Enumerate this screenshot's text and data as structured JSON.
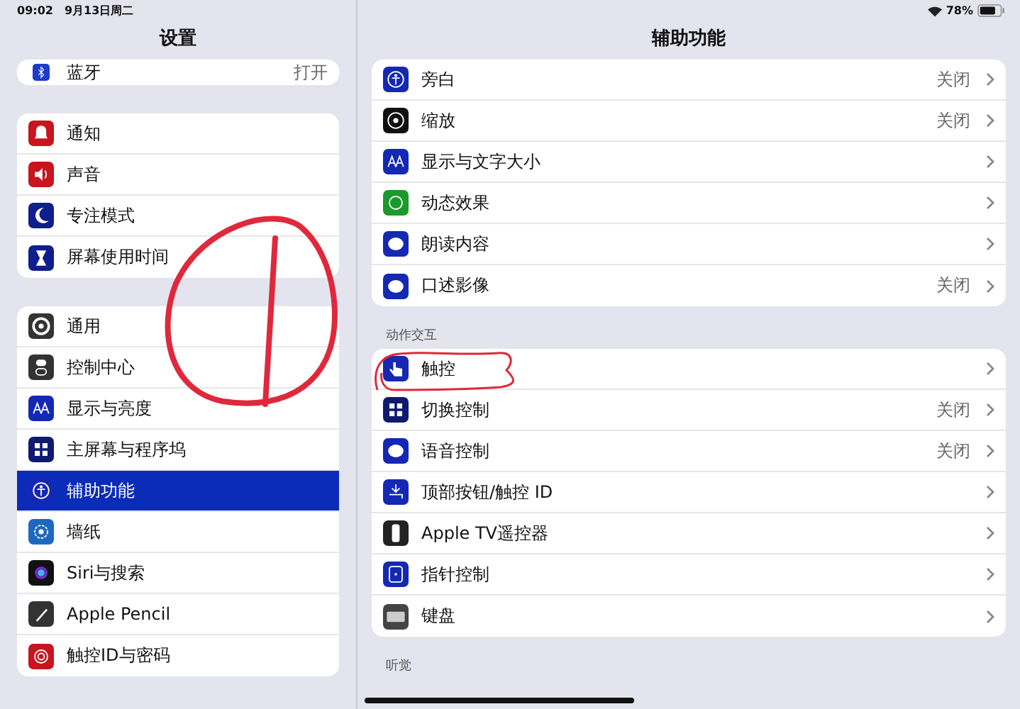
{
  "status_bar": {
    "time": "09:02",
    "date": "9月13日周二",
    "battery_text": "78%"
  },
  "sidebar": {
    "title": "设置",
    "groups": [
      [
        {
          "label": "蓝牙",
          "value": "打开",
          "selected": false
        }
      ],
      [
        {
          "label": "通知",
          "selected": false
        },
        {
          "label": "声音",
          "selected": false
        },
        {
          "label": "专注模式",
          "selected": false
        },
        {
          "label": "屏幕使用时间",
          "selected": false
        }
      ],
      [
        {
          "label": "通用",
          "selected": false
        },
        {
          "label": "控制中心",
          "selected": false
        },
        {
          "label": "显示与亮度",
          "selected": false
        },
        {
          "label": "主屏幕与程序坞",
          "selected": false
        },
        {
          "label": "辅助功能",
          "selected": true
        },
        {
          "label": "墙纸",
          "selected": false
        },
        {
          "label": "Siri与搜索",
          "selected": false
        },
        {
          "label": "Apple Pencil",
          "selected": false
        },
        {
          "label": "触控ID与密码",
          "selected": false
        }
      ]
    ]
  },
  "detail": {
    "title": "辅助功能",
    "sections": [
      {
        "rows": [
          {
            "label": "旁白",
            "value": "关闭"
          },
          {
            "label": "缩放",
            "value": "关闭"
          },
          {
            "label": "显示与文字大小"
          },
          {
            "label": "动态效果"
          },
          {
            "label": "朗读内容"
          },
          {
            "label": "口述影像",
            "value": "关闭"
          }
        ]
      },
      {
        "header": "动作交互",
        "rows": [
          {
            "label": "触控"
          },
          {
            "label": "切换控制",
            "value": "关闭"
          },
          {
            "label": "语音控制",
            "value": "关闭"
          },
          {
            "label": "顶部按钮/触控 ID"
          },
          {
            "label": "Apple TV遥控器"
          },
          {
            "label": "指针控制"
          },
          {
            "label": "键盘"
          }
        ]
      },
      {
        "header": "听觉"
      }
    ]
  }
}
